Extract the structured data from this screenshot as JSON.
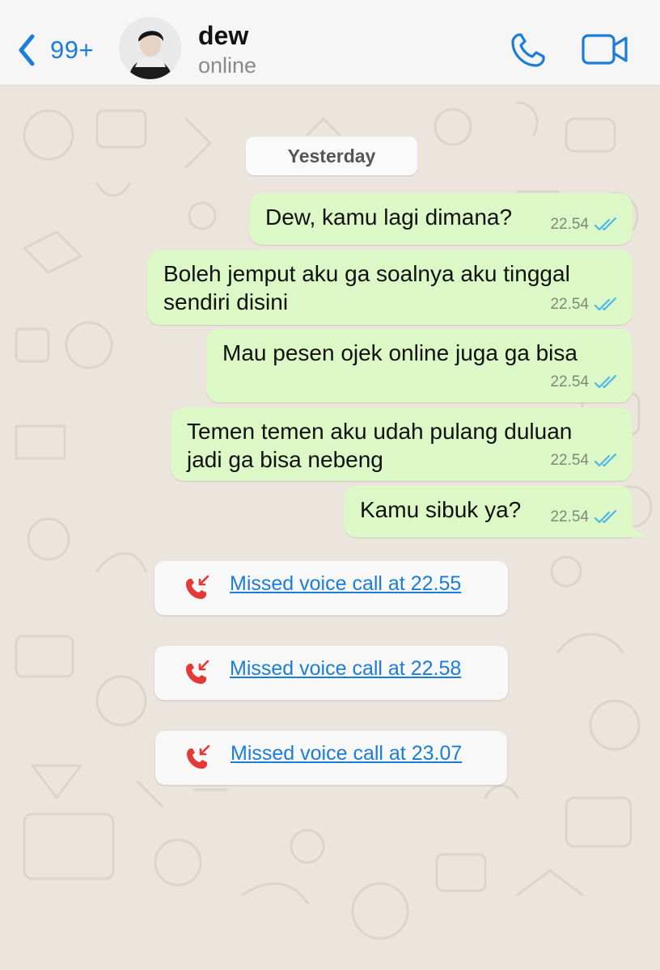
{
  "header": {
    "back_count": "99+",
    "contact_name": "dew",
    "contact_status": "online",
    "accent_color": "#1a7dd7"
  },
  "chat": {
    "date_label": "Yesterday",
    "messages": [
      {
        "lines": [
          "Dew, kamu lagi dimana?"
        ],
        "time": "22.54",
        "status": "read"
      },
      {
        "lines": [
          "Boleh jemput aku ga soalnya aku tinggal",
          "sendiri disini"
        ],
        "time": "22.54",
        "status": "read"
      },
      {
        "lines": [
          "Mau pesen ojek online juga ga bisa"
        ],
        "time": "22.54",
        "status": "read"
      },
      {
        "lines": [
          "Temen temen aku udah pulang duluan",
          "jadi ga bisa nebeng"
        ],
        "time": "22.54",
        "status": "read"
      },
      {
        "lines": [
          "Kamu sibuk ya?"
        ],
        "time": "22.54",
        "status": "read"
      }
    ],
    "missed_calls": [
      {
        "label": "Missed voice call at 22.55"
      },
      {
        "label": "Missed voice call at 22.58"
      },
      {
        "label": "Missed voice call at 23.07"
      }
    ]
  },
  "icons": {
    "back": "chevron-left-icon",
    "call": "phone-icon",
    "video": "video-camera-icon",
    "read_receipt": "double-check-icon",
    "missed_call": "missed-call-icon"
  },
  "colors": {
    "outgoing_bubble": "#dcf8c6",
    "read_tick": "#4fb6ec",
    "missed_call_red": "#e53935"
  }
}
